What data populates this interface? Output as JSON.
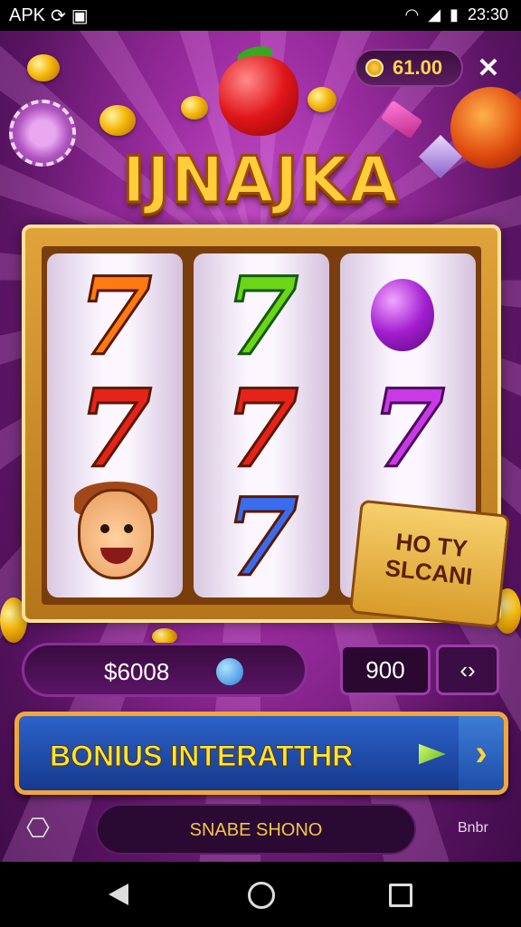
{
  "status_bar": {
    "carrier": "APK",
    "time": "23:30"
  },
  "header": {
    "coins": "61.00",
    "close_icon": "close-icon"
  },
  "game": {
    "title": "IJNAJKA",
    "reels": [
      [
        "7",
        "7",
        "face"
      ],
      [
        "7",
        "7",
        "7"
      ],
      [
        "plum",
        "7",
        ""
      ]
    ],
    "banner_text": "HO TY SLCANI"
  },
  "controls": {
    "balance": "$6008",
    "bet": "900",
    "bet_arrows": "‹›",
    "bonus_button": "BONIUS INTERATTHR",
    "share_button": "SNABE SHONO",
    "right_label": "Bnbr"
  },
  "colors": {
    "background": "#9a2c9f",
    "gold": "#ffce3a",
    "button_blue": "#2c62c8",
    "button_border": "#f2a73b"
  }
}
